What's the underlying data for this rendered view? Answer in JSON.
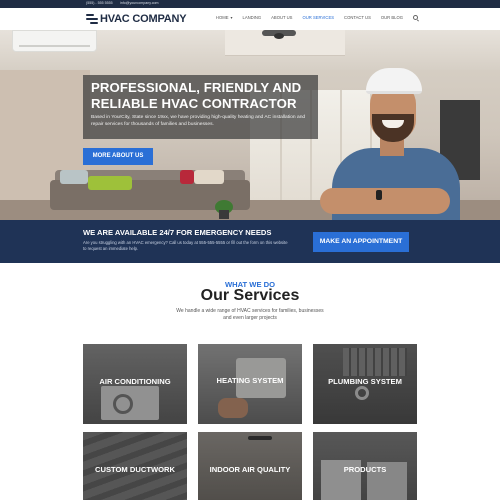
{
  "topbar": {
    "phone": "(555) - 555 5555",
    "email": "info@yourcompany.com"
  },
  "header": {
    "logo_text": "HVAC COMPANY",
    "nav": [
      {
        "label": "Home",
        "has_dropdown": true,
        "active": false
      },
      {
        "label": "Landing",
        "active": false
      },
      {
        "label": "About Us",
        "active": false
      },
      {
        "label": "Our Services",
        "active": true
      },
      {
        "label": "Contact Us",
        "active": false
      },
      {
        "label": "Our Blog",
        "active": false
      }
    ]
  },
  "hero": {
    "title": "Professional, Friendly and Reliable HVAC Contractor",
    "description": "Based in YourCity, State since 19xx, we have providing high-quality heating and AC installation and repair services for thousands of families and businesses.",
    "button_label": "More About Us"
  },
  "emergency": {
    "title": "We Are Available 24/7 for Emergency Needs",
    "description": "Are you struggling with an HVAC emergency? Call us today at 555-555-5555 or fill out the form on this website to request an immediate help.",
    "button_label": "Make an Appointment"
  },
  "services": {
    "kicker": "What We Do",
    "title": "Our Services",
    "description": "We handle a wide range of HVAC services for families, businesses and even larger projects",
    "items": [
      {
        "label": "Air Conditioning"
      },
      {
        "label": "Heating System"
      },
      {
        "label": "Plumbing System"
      },
      {
        "label": "Custom Ductwork"
      },
      {
        "label": "Indoor Air Quality"
      },
      {
        "label": "Products"
      }
    ]
  },
  "colors": {
    "accent": "#2a6fd6",
    "navy": "#1f3356",
    "dark": "#1f2c44"
  }
}
